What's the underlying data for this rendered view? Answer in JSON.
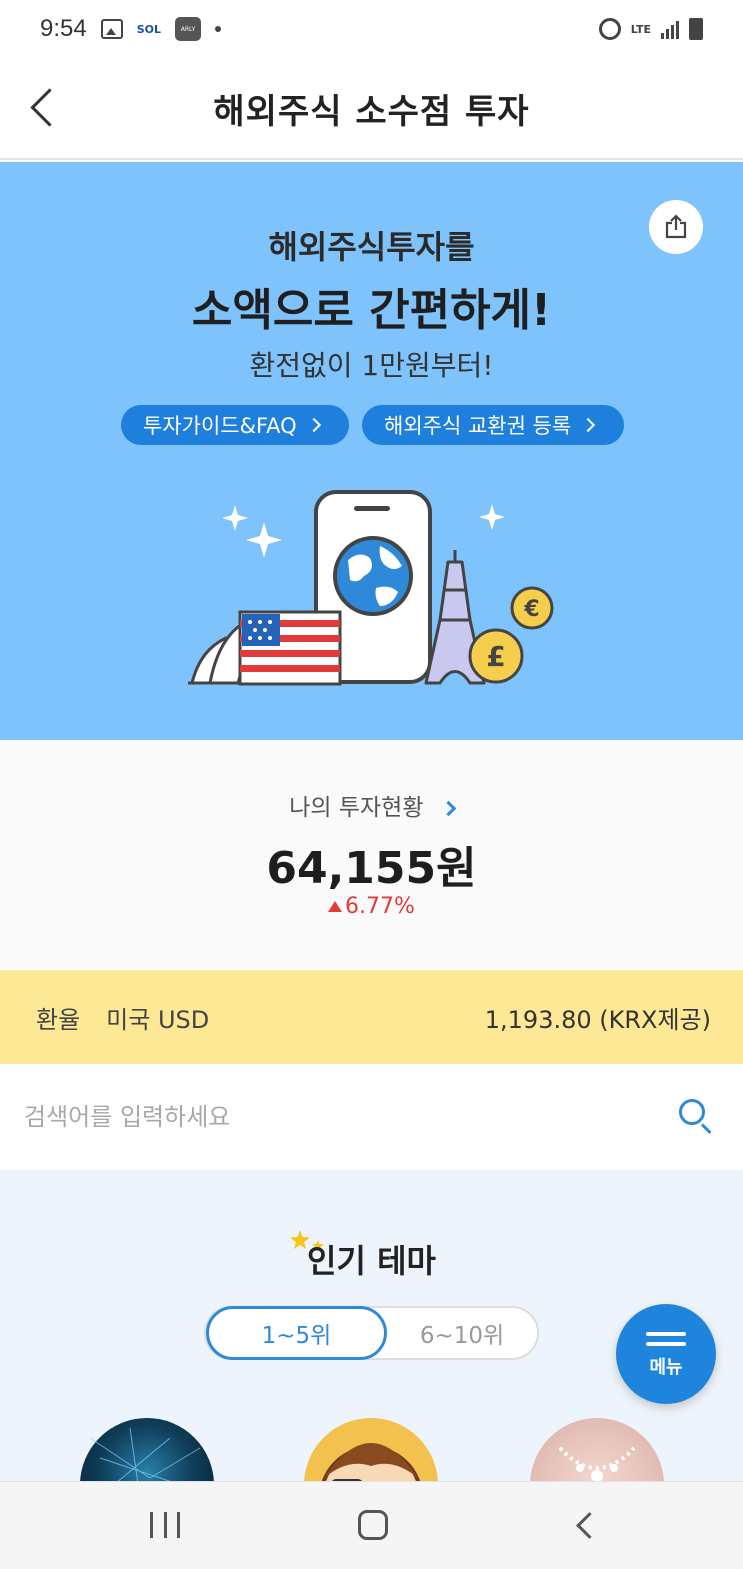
{
  "status_bar": {
    "time": "9:54",
    "sol_label": "SOL",
    "arly_label": "ARLY",
    "network_label": "LTE"
  },
  "header": {
    "title": "해외주식 소수점 투자"
  },
  "banner": {
    "subtitle": "해외주식투자를",
    "headline": "소액으로 간편하게!",
    "description": "환전없이 1만원부터!",
    "buttons": [
      {
        "label": "투자가이드&FAQ"
      },
      {
        "label": "해외주식 교환권 등록"
      }
    ],
    "illustration_icons": [
      "phone-globe-icon",
      "us-flag-icon",
      "opera-house-icon",
      "eiffel-tower-icon",
      "euro-coin-icon",
      "pound-coin-icon",
      "sparkle-icon"
    ],
    "colors": {
      "background": "#7ec3fb",
      "button": "#1f7fdd"
    }
  },
  "investment": {
    "label": "나의 투자현황",
    "amount": "64,155원",
    "change": "6.77%",
    "colors": {
      "up": "#e23b3b",
      "accent": "#2e8ad8"
    }
  },
  "exchange_rate": {
    "label": "환율",
    "currency": "미국 USD",
    "value": "1,193.80 (KRX제공)",
    "colors": {
      "background": "#fde896"
    }
  },
  "search": {
    "placeholder": "검색어를 입력하세요"
  },
  "popular_theme": {
    "title": "인기 테마",
    "tabs": [
      {
        "label": "1~5위",
        "active": true
      },
      {
        "label": "6~10위",
        "active": false
      }
    ]
  },
  "menu_button": {
    "label": "메뉴"
  },
  "nav_bar": {
    "icons": [
      "recent-apps-icon",
      "home-icon",
      "back-icon"
    ]
  }
}
